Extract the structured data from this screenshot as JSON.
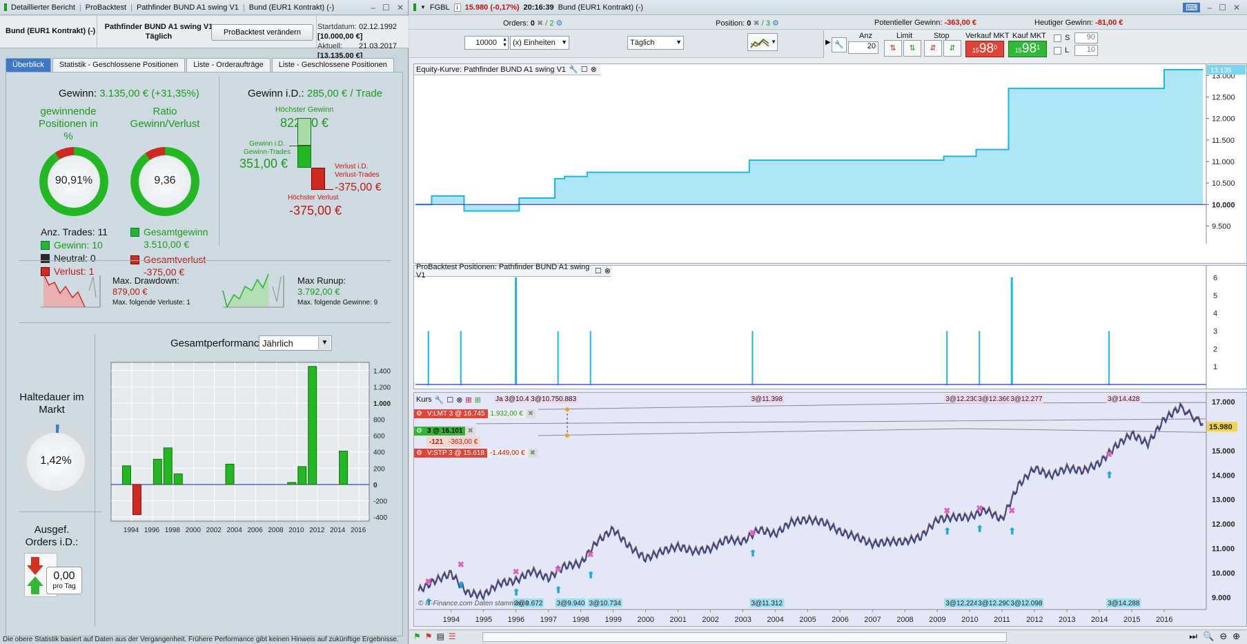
{
  "left_window": {
    "breadcrumb": [
      "Detaillierter Bericht",
      "ProBacktest",
      "Pathfinder BUND A1 swing V1",
      "Bund (EUR1 Kontrakt) (-)"
    ],
    "instrument": "Bund (EUR1 Kontrakt) (-)",
    "system_name": "Pathfinder BUND A1 swing V1",
    "timeframe": "Täglich",
    "modify_button": "ProBacktest verändern",
    "start_label": "Startdatum:",
    "start_date": "02.12.1992",
    "start_value": "[10.000,00 €]",
    "current_label": "Aktuell:",
    "current_date": "21.03.2017",
    "current_value": "[13.135,00 €]",
    "tabs": [
      "Überblick",
      "Statistik - Geschlossene Positionen",
      "Liste - Orderaufträge",
      "Liste - Geschlossene Positionen"
    ],
    "summary": {
      "gain_label": "Gewinn:",
      "gain_value": "3.135,00 € (+31,35%)",
      "winning_label_1": "gewinnende",
      "winning_label_2": "Positionen in",
      "winning_label_3": "%",
      "winning_pct": "90,91%",
      "winning_fraction": 0.9091,
      "ratio_label_1": "Ratio",
      "ratio_label_2": "Gewinn/Verlust",
      "ratio_value": "9,36",
      "ratio_fraction": 0.9035,
      "trades_label": "Anz. Trades: 11",
      "gain_count": "Gewinn: 10",
      "neutral_count": "Neutral: 0",
      "loss_count": "Verlust: 1",
      "total_gain_label": "Gesamtgewinn",
      "total_gain_value": "3.510,00 €",
      "total_loss_label": "Gesamtverlust",
      "total_loss_value": "-375,00 €"
    },
    "per_trade": {
      "label": "Gewinn i.D.:",
      "value": "285,00 € / Trade",
      "max_gain_label": "Höchster Gewinn",
      "max_gain_value": "822,00 €",
      "avg_gain_label_1": "Gewinn i.D.",
      "avg_gain_label_2": "Gewinn-Trades",
      "avg_gain_value": "351,00 €",
      "avg_loss_label_1": "Verlust i.D.",
      "avg_loss_label_2": "Verlust-Trades",
      "avg_loss_value": "-375,00 €",
      "max_loss_label": "Höchster Verlust",
      "max_loss_value": "-375,00 €"
    },
    "drawdown": {
      "label": "Max. Drawdown:",
      "value": "879,00 €",
      "sub": "Max. folgende Verluste: 1"
    },
    "runup": {
      "label": "Max Runup:",
      "value": "3.792,00 €",
      "sub": "Max. folgende Gewinne: 9"
    },
    "holding": {
      "label_1": "Haltedauer im",
      "label_2": "Markt",
      "value": "1,42%",
      "fraction": 0.0142
    },
    "orders": {
      "label_1": "Ausgef.",
      "label_2": "Orders i.D.:",
      "value": "0,00",
      "unit": "pro Tag"
    },
    "perf": {
      "title": "Gesamtperformance",
      "period": "Jährlich"
    },
    "footer": "Die obere Statistik basiert auf Daten aus der Vergangenheit. Frühere Performance gibt keinen Hinweis auf zukünftige Ergebnisse.",
    "colors": {
      "gain": "#22b822",
      "loss": "#d02a20",
      "neutral": "#2a2a2a",
      "accent": "#3b79c6"
    }
  },
  "chart_data": [
    {
      "type": "bar",
      "title": "Gesamtperformance",
      "x": [
        1993,
        1994,
        1996,
        1997,
        1998,
        2003,
        2009,
        2010,
        2011,
        2014
      ],
      "values": [
        230,
        -370,
        310,
        450,
        130,
        250,
        25,
        220,
        1450,
        410
      ],
      "ylim": [
        -450,
        1500
      ],
      "yticks": [
        -400,
        -200,
        0,
        200,
        400,
        600,
        800,
        1000,
        1200,
        1400
      ],
      "xticks": [
        1994,
        1996,
        1998,
        2000,
        2002,
        2004,
        2006,
        2008,
        2010,
        2012,
        2014,
        2016
      ],
      "xlim": [
        1992,
        2017
      ]
    },
    {
      "type": "line",
      "title": "Equity-Kurve: Pathfinder BUND A1 swing V1",
      "x": [
        1992.9,
        1993.2,
        1993.4,
        1994.2,
        1994.4,
        1995.4,
        1996.0,
        1996.1,
        1996.5,
        1997.2,
        1997.5,
        1998.2,
        2003.2,
        2009.2,
        2010.2,
        2011.2,
        2011.5,
        2014.2,
        2016.0,
        2017.2
      ],
      "values": [
        10000,
        10000,
        10200,
        10200,
        9850,
        9850,
        9850,
        10150,
        10150,
        10600,
        10650,
        10750,
        11030,
        11120,
        11280,
        12700,
        12700,
        12700,
        13135,
        13135
      ],
      "ylim": [
        9250,
        13200
      ],
      "yticks": [
        9500,
        10000,
        10500,
        11000,
        11500,
        12000,
        12500,
        13000
      ],
      "last_value": "13.135"
    },
    {
      "type": "bar",
      "title": "ProBacktest Positionen: Pathfinder BUND A1 swing V1",
      "x": [
        1993.3,
        1994.3,
        1996.0,
        1997.3,
        1998.3,
        2003.3,
        2009.3,
        2010.3,
        2011.3,
        2014.3
      ],
      "values": [
        3,
        3,
        6,
        3,
        3,
        3,
        3,
        3,
        6,
        3
      ],
      "ylim": [
        0,
        6.5
      ],
      "yticks": [
        1,
        2,
        3,
        4,
        5,
        6
      ]
    },
    {
      "type": "line",
      "title": "Kurs",
      "x": [
        1993.0,
        1993.5,
        1994.0,
        1994.5,
        1995.0,
        1995.5,
        1996.0,
        1996.5,
        1997.0,
        1997.5,
        1998.0,
        1998.5,
        1999.0,
        1999.5,
        2000.0,
        2000.5,
        2001.0,
        2001.5,
        2002.0,
        2002.5,
        2003.0,
        2003.5,
        2004.0,
        2004.5,
        2005.0,
        2005.5,
        2006.0,
        2006.5,
        2007.0,
        2007.5,
        2008.0,
        2008.5,
        2009.0,
        2009.5,
        2010.0,
        2010.5,
        2011.0,
        2011.5,
        2012.0,
        2012.5,
        2013.0,
        2013.5,
        2014.0,
        2014.5,
        2015.0,
        2015.5,
        2016.0,
        2016.5,
        2017.2
      ],
      "values": [
        9.3,
        9.7,
        10.0,
        9.2,
        9.1,
        9.6,
        9.7,
        10.1,
        9.8,
        10.3,
        10.4,
        11.3,
        11.8,
        11.1,
        10.6,
        10.9,
        11.1,
        10.9,
        11.0,
        11.4,
        11.3,
        11.8,
        11.6,
        12.1,
        12.2,
        12.1,
        11.7,
        11.5,
        11.2,
        11.3,
        11.3,
        11.5,
        12.2,
        12.3,
        12.3,
        12.6,
        12.2,
        13.6,
        14.3,
        14.0,
        14.3,
        14.2,
        14.5,
        15.2,
        15.7,
        15.3,
        16.3,
        16.8,
        16.1
      ],
      "ylim": [
        8.5,
        17.2
      ],
      "yticks": [
        9,
        10,
        11,
        12,
        13,
        14,
        15,
        16,
        17
      ],
      "xticks": [
        1994,
        1995,
        1996,
        1997,
        1998,
        1999,
        2000,
        2001,
        2002,
        2003,
        2004,
        2005,
        2006,
        2007,
        2008,
        2009,
        2010,
        2011,
        2012,
        2013,
        2014,
        2015,
        2016
      ],
      "xlim": [
        1992.9,
        2017.3
      ],
      "last_price": "15.980"
    }
  ],
  "right_window": {
    "title_symbol": "FGBL",
    "title_price": "15.980 (-0,17%)",
    "title_time": "20:16:39",
    "title_name": "Bund (EUR1 Kontrakt) (-)",
    "orders_label": "Orders:",
    "orders_value": "0",
    "orders_total": "/ 2",
    "position_label": "Position:",
    "position_value": "0",
    "position_total": "/ 3",
    "potential_label": "Potentieller Gewinn:",
    "potential_value": "-363,00 €",
    "today_label": "Heutiger Gewinn:",
    "today_value": "-81,00 €",
    "qty_value": "10000",
    "qty_unit": "(x) Einheiten",
    "period": "Täglich",
    "anz_label": "Anz",
    "anz_value": "20",
    "limit_label": "Limit",
    "stop_label": "Stop",
    "sell_label": "Verkauf MKT",
    "sell_price_small": "15",
    "sell_price_big": "98",
    "sell_price_sup": "0",
    "buy_label": "Kauf MKT",
    "buy_price_small": "15",
    "buy_price_big": "98",
    "buy_price_sup": "1",
    "s_label": "S",
    "s_value": "90",
    "l_label": "L",
    "l_value": "10",
    "kurs_label": "Kurs",
    "order_vlmt": "V:LMT  3 @ 16.745",
    "order_vlmt_gain": "1.932,00 €",
    "order_pos": "3 @ 16.101",
    "order_pos_pts": "-121",
    "order_pos_gain": "-363,00 €",
    "order_vstp": "V:STP  3 @ 15.618",
    "order_vstp_gain": "-1.449,00 €",
    "top_labels": [
      "3@11.398",
      "3@12.230",
      "3@12.366",
      "3@12.277",
      "3@14.428"
    ],
    "top_overlap": "Ja 3@10.4 3@10.750.883",
    "bottom_labels": [
      "3@9.672",
      "3@9.940",
      "3@10.734",
      "3@11.312",
      "3@12.224",
      "3@12.290",
      "3@12.098",
      "3@14.288"
    ],
    "watermark": "© IT-Finance.com   Daten stammen a"
  }
}
